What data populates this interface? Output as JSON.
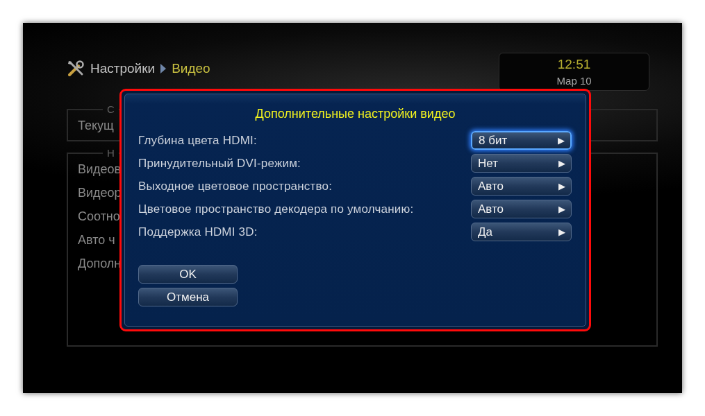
{
  "breadcrumb": [
    {
      "label": "Настройки",
      "selected": false
    },
    {
      "label": "Видео",
      "selected": true
    }
  ],
  "clock": {
    "time": "12:51",
    "date": "Мар 10"
  },
  "background_panels": [
    {
      "legend": "С",
      "items": [
        "Текущ"
      ]
    },
    {
      "legend": "Н",
      "items": [
        "Видеов",
        "Видеор",
        "Соотно",
        "Авто ч",
        "Дополн"
      ]
    }
  ],
  "dialog": {
    "title": "Дополнительные настройки видео",
    "rows": [
      {
        "label": "Глубина цвета HDMI:",
        "value": "8 бит",
        "arrow": "▶",
        "selected": true
      },
      {
        "label": "Принудительный DVI-режим:",
        "value": "Нет",
        "arrow": "▶",
        "selected": false
      },
      {
        "label": "Выходное цветовое пространство:",
        "value": "Авто",
        "arrow": "▶",
        "selected": false
      },
      {
        "label": "Цветовое пространство декодера по умолчанию:",
        "value": "Авто",
        "arrow": "▶",
        "selected": false
      },
      {
        "label": "Поддержка HDMI 3D:",
        "value": "Да",
        "arrow": "▶",
        "selected": false
      }
    ],
    "buttons": [
      "OK",
      "Отмена"
    ]
  }
}
